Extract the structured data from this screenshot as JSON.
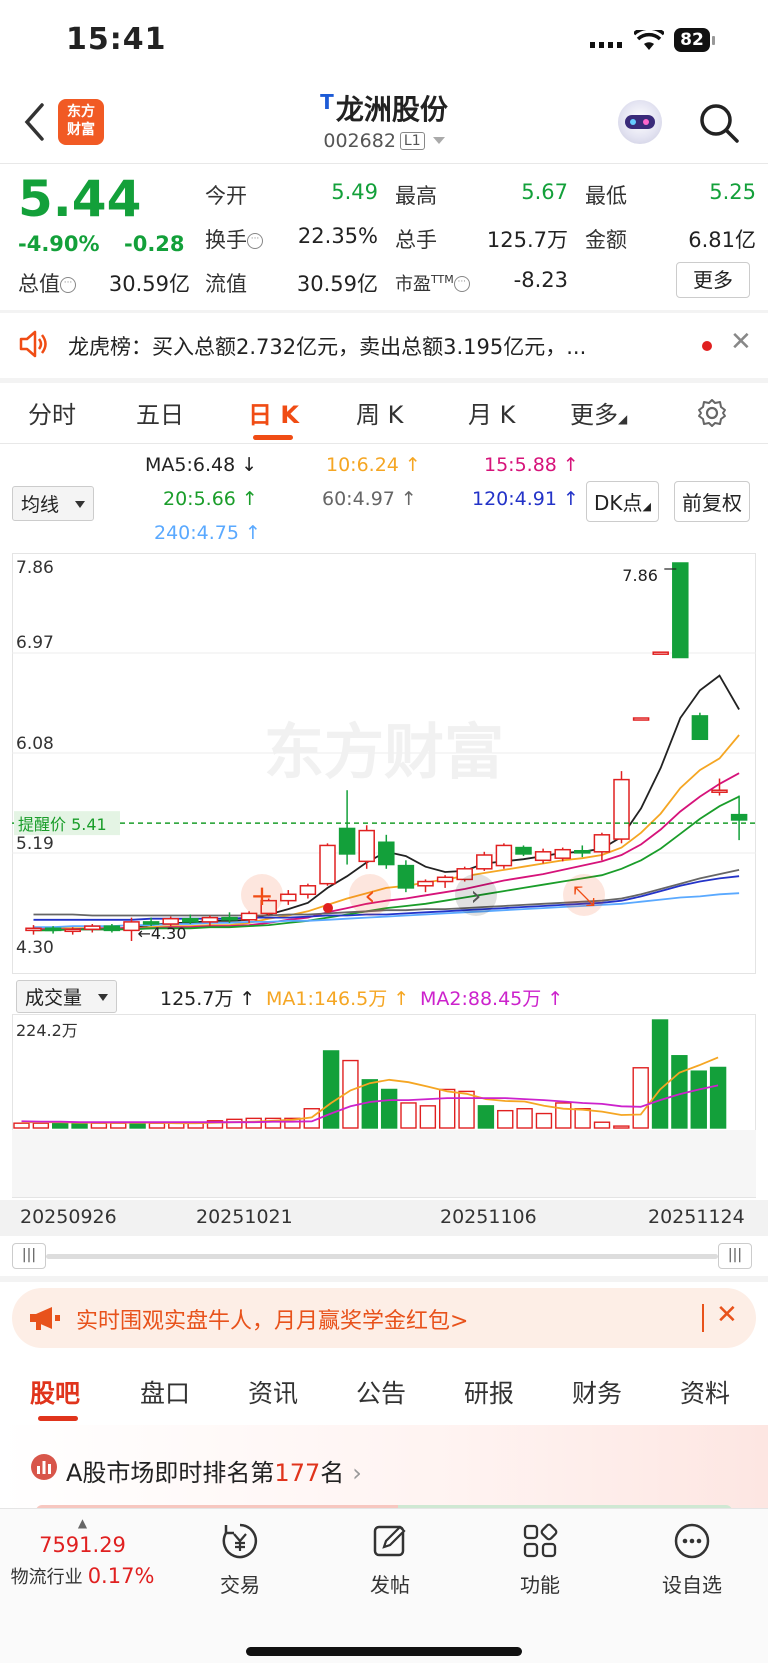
{
  "status": {
    "time": "15:41",
    "battery": "82"
  },
  "header": {
    "logo_line1": "东方",
    "logo_line2": "财富",
    "name": "龙洲股份",
    "name_badge": "T",
    "code": "002682",
    "level": "L1"
  },
  "quote": {
    "price": "5.44",
    "pct": "-4.90%",
    "change": "-0.28",
    "open_label": "今开",
    "open": "5.49",
    "high_label": "最高",
    "high": "5.67",
    "low_label": "最低",
    "low": "5.25",
    "turnover_label": "换手",
    "turnover": "22.35%",
    "vol_label": "总手",
    "vol": "125.7万",
    "amount_label": "金额",
    "amount": "6.81亿",
    "mcap_label": "总值",
    "mcap": "30.59亿",
    "float_label": "流值",
    "float": "30.59亿",
    "pe_label": "市盈",
    "pe_sup": "TTM",
    "pe": "-8.23",
    "more": "更多"
  },
  "dragon": {
    "text": "龙虎榜：买入总额2.732亿元，卖出总额3.195亿元，..."
  },
  "ktabs": [
    "分时",
    "五日",
    "日 K",
    "周 K",
    "月 K",
    "更多"
  ],
  "ma": {
    "selector": "均线",
    "ma5": "MA5:6.48 ↓",
    "ma10": "10:6.24 ↑",
    "ma15": "15:5.88 ↑",
    "ma20": "20:5.66 ↑",
    "ma60": "60:4.97 ↑",
    "ma120": "120:4.91 ↑",
    "ma240": "240:4.75 ↑",
    "dk": "DK点",
    "fq": "前复权",
    "colors": {
      "ma5": "#222222",
      "ma10": "#f5a623",
      "ma15": "#d6137a",
      "ma20": "#1a9d2a",
      "ma60": "#666666",
      "ma120": "#2333c8",
      "ma240": "#5aa9ff"
    }
  },
  "kchart": {
    "y_labels": [
      "7.86",
      "6.97",
      "6.08",
      "5.19",
      "4.30"
    ],
    "high_label": "7.86",
    "low_label": "4.30",
    "alert": "提醒价 5.41",
    "watermark": "东方财富"
  },
  "chart_data": [
    {
      "type": "candlestick",
      "ylim": [
        4.3,
        7.86
      ],
      "candles": [
        {
          "o": 4.4,
          "h": 4.45,
          "l": 4.36,
          "c": 4.42
        },
        {
          "o": 4.42,
          "h": 4.44,
          "l": 4.37,
          "c": 4.4
        },
        {
          "o": 4.4,
          "h": 4.43,
          "l": 4.36,
          "c": 4.41
        },
        {
          "o": 4.41,
          "h": 4.46,
          "l": 4.38,
          "c": 4.44
        },
        {
          "o": 4.44,
          "h": 4.46,
          "l": 4.38,
          "c": 4.4
        },
        {
          "o": 4.4,
          "h": 4.52,
          "l": 4.3,
          "c": 4.48
        },
        {
          "o": 4.48,
          "h": 4.52,
          "l": 4.44,
          "c": 4.46
        },
        {
          "o": 4.46,
          "h": 4.53,
          "l": 4.44,
          "c": 4.51
        },
        {
          "o": 4.51,
          "h": 4.55,
          "l": 4.46,
          "c": 4.48
        },
        {
          "o": 4.48,
          "h": 4.54,
          "l": 4.44,
          "c": 4.52
        },
        {
          "o": 4.52,
          "h": 4.57,
          "l": 4.47,
          "c": 4.5
        },
        {
          "o": 4.5,
          "h": 4.58,
          "l": 4.47,
          "c": 4.56
        },
        {
          "o": 4.56,
          "h": 4.7,
          "l": 4.54,
          "c": 4.68
        },
        {
          "o": 4.68,
          "h": 4.78,
          "l": 4.64,
          "c": 4.74
        },
        {
          "o": 4.74,
          "h": 4.84,
          "l": 4.7,
          "c": 4.82
        },
        {
          "o": 4.84,
          "h": 5.22,
          "l": 4.82,
          "c": 5.2
        },
        {
          "o": 5.36,
          "h": 5.72,
          "l": 5.02,
          "c": 5.12
        },
        {
          "o": 5.05,
          "h": 5.39,
          "l": 4.98,
          "c": 5.34
        },
        {
          "o": 5.23,
          "h": 5.3,
          "l": 4.98,
          "c": 5.02
        },
        {
          "o": 5.01,
          "h": 5.06,
          "l": 4.76,
          "c": 4.8
        },
        {
          "o": 4.82,
          "h": 4.88,
          "l": 4.76,
          "c": 4.86
        },
        {
          "o": 4.86,
          "h": 4.92,
          "l": 4.8,
          "c": 4.9
        },
        {
          "o": 4.88,
          "h": 5.0,
          "l": 4.86,
          "c": 4.98
        },
        {
          "o": 4.98,
          "h": 5.14,
          "l": 4.96,
          "c": 5.11
        },
        {
          "o": 5.01,
          "h": 5.22,
          "l": 4.98,
          "c": 5.2
        },
        {
          "o": 5.18,
          "h": 5.2,
          "l": 5.1,
          "c": 5.12
        },
        {
          "o": 5.06,
          "h": 5.17,
          "l": 5.03,
          "c": 5.14
        },
        {
          "o": 5.08,
          "h": 5.18,
          "l": 5.05,
          "c": 5.16
        },
        {
          "o": 5.15,
          "h": 5.2,
          "l": 5.09,
          "c": 5.13
        },
        {
          "o": 5.14,
          "h": 5.32,
          "l": 5.06,
          "c": 5.3
        },
        {
          "o": 5.26,
          "h": 5.9,
          "l": 5.22,
          "c": 5.82
        },
        {
          "o": 6.4,
          "h": 6.4,
          "l": 6.4,
          "c": 6.4
        },
        {
          "o": 7.02,
          "h": 7.02,
          "l": 7.02,
          "c": 7.02
        },
        {
          "o": 7.86,
          "h": 7.86,
          "l": 6.97,
          "c": 6.97
        },
        {
          "o": 6.42,
          "h": 6.45,
          "l": 6.2,
          "c": 6.2
        },
        {
          "o": 5.72,
          "h": 5.83,
          "l": 5.67,
          "c": 5.72
        },
        {
          "o": 5.49,
          "h": 5.67,
          "l": 5.25,
          "c": 5.44
        }
      ],
      "ma_lines": {
        "ma5": [
          4.42,
          4.42,
          4.41,
          4.41,
          4.41,
          4.43,
          4.45,
          4.47,
          4.47,
          4.49,
          4.49,
          4.5,
          4.55,
          4.6,
          4.66,
          4.8,
          4.91,
          5.04,
          5.14,
          5.1,
          5.0,
          4.95,
          4.96,
          5.03,
          5.05,
          5.07,
          5.1,
          5.13,
          5.14,
          5.17,
          5.28,
          5.55,
          5.93,
          6.4,
          6.66,
          6.8,
          6.48
        ],
        "ma10": [
          4.42,
          4.42,
          4.42,
          4.42,
          4.42,
          4.42,
          4.43,
          4.44,
          4.44,
          4.45,
          4.45,
          4.47,
          4.51,
          4.54,
          4.58,
          4.64,
          4.7,
          4.75,
          4.8,
          4.82,
          4.85,
          4.88,
          4.91,
          4.94,
          4.97,
          5.0,
          5.03,
          5.06,
          5.08,
          5.11,
          5.18,
          5.32,
          5.5,
          5.74,
          5.91,
          6.02,
          6.24
        ],
        "ma15": [
          4.41,
          4.41,
          4.41,
          4.42,
          4.42,
          4.42,
          4.42,
          4.43,
          4.43,
          4.44,
          4.44,
          4.45,
          4.47,
          4.5,
          4.52,
          4.57,
          4.61,
          4.65,
          4.68,
          4.7,
          4.73,
          4.76,
          4.79,
          4.83,
          4.87,
          4.9,
          4.93,
          4.97,
          5.01,
          5.05,
          5.11,
          5.21,
          5.35,
          5.52,
          5.66,
          5.78,
          5.88
        ],
        "ma20": [
          4.4,
          4.4,
          4.41,
          4.41,
          4.41,
          4.41,
          4.42,
          4.42,
          4.42,
          4.43,
          4.43,
          4.44,
          4.45,
          4.47,
          4.49,
          4.52,
          4.55,
          4.58,
          4.61,
          4.63,
          4.65,
          4.68,
          4.71,
          4.74,
          4.77,
          4.8,
          4.83,
          4.86,
          4.89,
          4.92,
          4.98,
          5.06,
          5.17,
          5.31,
          5.45,
          5.57,
          5.66
        ],
        "ma60": [
          4.55,
          4.55,
          4.55,
          4.54,
          4.54,
          4.54,
          4.54,
          4.54,
          4.54,
          4.54,
          4.54,
          4.54,
          4.54,
          4.55,
          4.55,
          4.56,
          4.57,
          4.58,
          4.59,
          4.59,
          4.6,
          4.6,
          4.61,
          4.62,
          4.63,
          4.64,
          4.65,
          4.66,
          4.67,
          4.68,
          4.7,
          4.74,
          4.79,
          4.84,
          4.89,
          4.93,
          4.97
        ],
        "ma120": [
          4.5,
          4.5,
          4.5,
          4.5,
          4.5,
          4.5,
          4.51,
          4.51,
          4.51,
          4.51,
          4.51,
          4.52,
          4.52,
          4.52,
          4.53,
          4.54,
          4.54,
          4.55,
          4.55,
          4.56,
          4.57,
          4.58,
          4.59,
          4.6,
          4.61,
          4.62,
          4.63,
          4.64,
          4.65,
          4.66,
          4.68,
          4.72,
          4.77,
          4.82,
          4.86,
          4.89,
          4.91
        ],
        "ma240": [
          4.43,
          4.43,
          4.44,
          4.44,
          4.44,
          4.45,
          4.45,
          4.46,
          4.46,
          4.47,
          4.47,
          4.48,
          4.48,
          4.49,
          4.49,
          4.5,
          4.51,
          4.52,
          4.53,
          4.54,
          4.55,
          4.56,
          4.57,
          4.58,
          4.59,
          4.6,
          4.61,
          4.62,
          4.63,
          4.64,
          4.65,
          4.67,
          4.69,
          4.71,
          4.72,
          4.74,
          4.75
        ]
      }
    },
    {
      "type": "bar",
      "title": "成交量",
      "ylim": [
        0,
        224.2
      ],
      "values": [
        10,
        10,
        9,
        10,
        10,
        10,
        9,
        10,
        10,
        10,
        15,
        18,
        20,
        20,
        20,
        40,
        160,
        140,
        100,
        80,
        52,
        46,
        80,
        76,
        46,
        36,
        40,
        30,
        52,
        40,
        12,
        4,
        125,
        224.2,
        150,
        118,
        125.7
      ],
      "up": [
        true,
        true,
        false,
        false,
        true,
        true,
        false,
        true,
        true,
        true,
        true,
        true,
        true,
        true,
        true,
        true,
        false,
        true,
        false,
        false,
        true,
        true,
        true,
        true,
        false,
        true,
        true,
        true,
        true,
        true,
        true,
        true,
        true,
        false,
        false,
        false,
        false
      ],
      "ma1": [
        12,
        12,
        12,
        11,
        11,
        11,
        11,
        11,
        10,
        10,
        11,
        12,
        13,
        15,
        17,
        22,
        52,
        78,
        93,
        100,
        95,
        86,
        76,
        71,
        60,
        56,
        55,
        46,
        40,
        38,
        34,
        27,
        28,
        80,
        115,
        130,
        146.5
      ],
      "ma2": [
        14,
        13,
        13,
        12,
        12,
        12,
        12,
        12,
        12,
        12,
        12,
        12,
        12,
        13,
        13,
        14,
        30,
        45,
        54,
        58,
        58,
        60,
        62,
        62,
        62,
        62,
        60,
        58,
        55,
        52,
        50,
        45,
        44,
        58,
        70,
        80,
        88.45
      ]
    }
  ],
  "volume": {
    "selector": "成交量",
    "total": "125.7万 ↑",
    "ma1": "MA1:146.5万 ↑",
    "ma2": "MA2:88.45万 ↑",
    "max": "224.2万",
    "ma1_color": "#f5a623",
    "ma2_color": "#cc22cc"
  },
  "dates": [
    "20250926",
    "20251021",
    "20251106",
    "20251124"
  ],
  "promo": {
    "text": "实时围观实盘牛人，月月赢奖学金红包>"
  },
  "btabs": [
    "股吧",
    "盘口",
    "资讯",
    "公告",
    "研报",
    "财务",
    "资料"
  ],
  "rank": {
    "prefix": "A股市场即时排名第",
    "num": "177",
    "suffix": "名"
  },
  "bottom": {
    "index_value": "7591.29",
    "index_name": "物流行业",
    "index_pct": "0.17%",
    "trade": "交易",
    "post": "发帖",
    "func": "功能",
    "watch": "设自选"
  },
  "colors": {
    "up": "#e02020",
    "down": "#13a03a",
    "accent": "#f04c14"
  }
}
